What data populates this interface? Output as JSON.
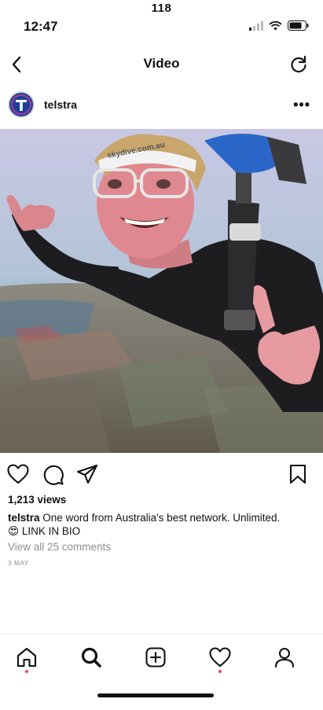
{
  "status_bar": {
    "top_number": "118",
    "time": "12:47"
  },
  "nav": {
    "title": "Video",
    "back_icon": "chevron-left-icon",
    "refresh_icon": "refresh-icon"
  },
  "post": {
    "username": "telstra",
    "more_label": "•••",
    "video_overlay_text": "skydive.com.au",
    "views": "1,213 views",
    "caption_user": "telstra",
    "caption_text": "One word from Australia's best network. Unlimited.",
    "caption_line2": "😍 LINK IN BIO",
    "comments_link": "View all 25 comments",
    "date": "3 MAY"
  },
  "tabs": [
    {
      "name": "home",
      "icon": "home-icon",
      "has_dot": true
    },
    {
      "name": "search",
      "icon": "search-icon",
      "has_dot": false
    },
    {
      "name": "create",
      "icon": "add-post-icon",
      "has_dot": false
    },
    {
      "name": "activity",
      "icon": "heart-icon",
      "has_dot": true
    },
    {
      "name": "profile",
      "icon": "profile-icon",
      "has_dot": false
    }
  ],
  "colors": {
    "notification_dot": "#ed4956",
    "brand_blue": "#1b3f9a",
    "secondary_text": "#8e8e8e"
  }
}
